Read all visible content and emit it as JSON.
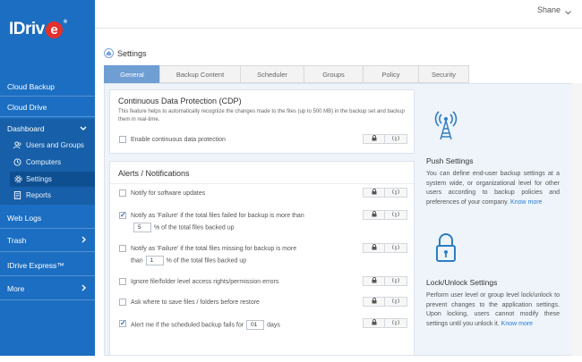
{
  "brand": {
    "name_left": "IDriv",
    "name_e": "e",
    "reg": "®"
  },
  "user": {
    "name": "Shane"
  },
  "sidebar": {
    "items": [
      {
        "label": "Cloud Backup"
      },
      {
        "label": "Cloud Drive"
      },
      {
        "label": "Dashboard"
      },
      {
        "label": "Web Logs"
      },
      {
        "label": "Trash"
      },
      {
        "label": "IDrive Express™"
      },
      {
        "label": "More"
      }
    ],
    "sub_items": [
      {
        "label": "Users and Groups",
        "icon": "users-icon"
      },
      {
        "label": "Computers",
        "icon": "computer-icon"
      },
      {
        "label": "Settings",
        "icon": "gear-icon",
        "active": true
      },
      {
        "label": "Reports",
        "icon": "report-icon"
      }
    ]
  },
  "breadcrumb": {
    "title": "Settings"
  },
  "tabs": [
    {
      "label": "General",
      "active": true
    },
    {
      "label": "Backup Content"
    },
    {
      "label": "Scheduler"
    },
    {
      "label": "Groups"
    },
    {
      "label": "Policy"
    },
    {
      "label": "Security"
    }
  ],
  "cdp": {
    "title": "Continuous Data Protection (CDP)",
    "description": "This feature helps to automatically recognize the changes made to the files (up to 500 MB) in the backup set and backup them in real-time.",
    "option": {
      "label": "Enable continuous data protection",
      "checked": false
    }
  },
  "alerts": {
    "title": "Alerts / Notifications",
    "options": [
      {
        "label": "Notify for software updates",
        "checked": false
      },
      {
        "label": "Notify as 'Failure' if the total files failed for backup is more than",
        "checked": true,
        "value": "5",
        "suffix": "% of the total files backed up"
      },
      {
        "label": "Notify as 'Failure' if the total files missing for backup is more",
        "checked": false,
        "prefix": "than",
        "value": "1",
        "suffix": "% of the total files backed up"
      },
      {
        "label": "Ignore file/folder level access rights/permission errors",
        "checked": false
      },
      {
        "label": "Ask where to save files / folders before restore",
        "checked": false
      },
      {
        "label": "Alert me if the scheduled backup fails for",
        "checked": true,
        "value": "01",
        "suffix": "days"
      }
    ]
  },
  "right_pane": {
    "push": {
      "title": "Push Settings",
      "text": "You can define end-user backup settings at a system wide, or organizational level for other users according to backup policies and preferences of your company.",
      "link": "Know more"
    },
    "lock": {
      "title": "Lock/Unlock Settings",
      "text": "Perform user level or group level lock/unlock to prevent changes to the application settings. Upon locking, users cannot modify these settings until you unlock it.",
      "link": "Know more"
    }
  },
  "colors": {
    "sidebar": "#1b6ec2",
    "accent": "#6f9ed2",
    "link": "#2b7bd6"
  }
}
